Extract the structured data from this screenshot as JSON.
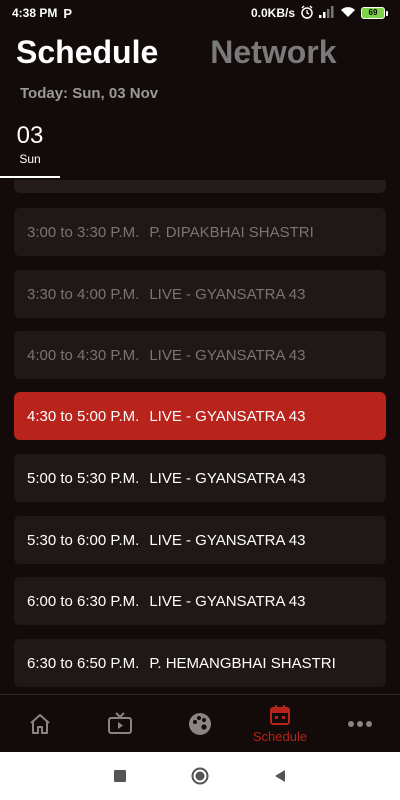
{
  "status_bar": {
    "time": "4:38 PM",
    "app_indicator": "P",
    "network_speed": "0.0KB/s",
    "battery_level": "69",
    "icons": [
      "alarm-icon",
      "signal-icon",
      "wifi-icon",
      "battery-icon"
    ]
  },
  "header": {
    "tabs": [
      {
        "label": "Schedule",
        "active": true
      },
      {
        "label": "Network",
        "active": false
      }
    ],
    "today_label": "Today: Sun, 03 Nov"
  },
  "days": [
    {
      "number": "03",
      "name": "Sun",
      "selected": true
    }
  ],
  "schedule": [
    {
      "time": "3:00 to 3:30 P.M.",
      "title": "P. DIPAKBHAI SHASTRI",
      "state": "past"
    },
    {
      "time": "3:30 to 4:00 P.M.",
      "title": "LIVE - GYANSATRA 43",
      "state": "past"
    },
    {
      "time": "4:00 to 4:30 P.M.",
      "title": "LIVE - GYANSATRA 43",
      "state": "past"
    },
    {
      "time": "4:30 to 5:00 P.M.",
      "title": "LIVE - GYANSATRA 43",
      "state": "current"
    },
    {
      "time": "5:00 to 5:30 P.M.",
      "title": "LIVE - GYANSATRA 43",
      "state": "upcoming"
    },
    {
      "time": "5:30 to 6:00 P.M.",
      "title": "LIVE - GYANSATRA 43",
      "state": "upcoming"
    },
    {
      "time": "6:00 to 6:30 P.M.",
      "title": "LIVE - GYANSATRA 43",
      "state": "upcoming"
    },
    {
      "time": "6:30 to 6:50 P.M.",
      "title": "P. HEMANGBHAI SHASTRI",
      "state": "upcoming"
    }
  ],
  "bottom_nav": {
    "items": [
      {
        "icon": "home-icon",
        "label": "",
        "active": false
      },
      {
        "icon": "tv-icon",
        "label": "",
        "active": false
      },
      {
        "icon": "palette-icon",
        "label": "",
        "active": false
      },
      {
        "icon": "calendar-icon",
        "label": "Schedule",
        "active": true
      },
      {
        "icon": "more-icon",
        "label": "",
        "active": false
      }
    ]
  },
  "system_nav": [
    "recents-button",
    "home-button",
    "back-button"
  ],
  "colors": {
    "background": "#120b0a",
    "card": "#201817",
    "accent": "#b8231b",
    "muted_text": "#7b7371",
    "inactive_tab": "#7a7a7a"
  }
}
